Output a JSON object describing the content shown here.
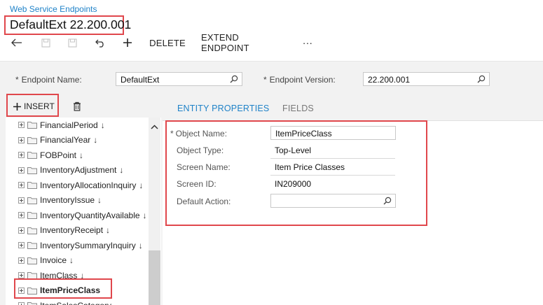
{
  "breadcrumb": "Web Service Endpoints",
  "title": "DefaultExt 22.200.001",
  "toolbar": {
    "back_icon": "undo-arrow-icon",
    "delete_label": "DELETE",
    "extend_label": "EXTEND ENDPOINT",
    "more_label": "···"
  },
  "form": {
    "endpoint_name_label": "Endpoint Name:",
    "endpoint_name_value": "DefaultExt",
    "endpoint_version_label": "Endpoint Version:",
    "endpoint_version_value": "22.200.001",
    "required_mark": "*"
  },
  "left": {
    "insert_label": "INSERT",
    "tree_items": [
      {
        "label": "FinancialPeriod",
        "arrow": "↓"
      },
      {
        "label": "FinancialYear",
        "arrow": "↓"
      },
      {
        "label": "FOBPoint",
        "arrow": "↓"
      },
      {
        "label": "InventoryAdjustment",
        "arrow": "↓"
      },
      {
        "label": "InventoryAllocationInquiry",
        "arrow": "↓"
      },
      {
        "label": "InventoryIssue",
        "arrow": "↓"
      },
      {
        "label": "InventoryQuantityAvailable",
        "arrow": "↓"
      },
      {
        "label": "InventoryReceipt",
        "arrow": "↓"
      },
      {
        "label": "InventorySummaryInquiry",
        "arrow": "↓"
      },
      {
        "label": "Invoice",
        "arrow": "↓"
      },
      {
        "label": "ItemClass",
        "arrow": "↓"
      },
      {
        "label": "ItemPriceClass",
        "arrow": ""
      },
      {
        "label": "ItemSalesCategory",
        "arrow": ""
      }
    ],
    "selected_index": 11
  },
  "tabs": {
    "entity_properties": "ENTITY PROPERTIES",
    "fields": "FIELDS"
  },
  "props": {
    "object_name_label": "Object Name:",
    "object_name_value": "ItemPriceClass",
    "object_type_label": "Object Type:",
    "object_type_value": "Top-Level",
    "screen_name_label": "Screen Name:",
    "screen_name_value": "Item Price Classes",
    "screen_id_label": "Screen ID:",
    "screen_id_value": "IN209000",
    "default_action_label": "Default Action:",
    "default_action_value": ""
  },
  "colors": {
    "accent": "#1f82c8",
    "highlight_border": "#e0474c"
  }
}
